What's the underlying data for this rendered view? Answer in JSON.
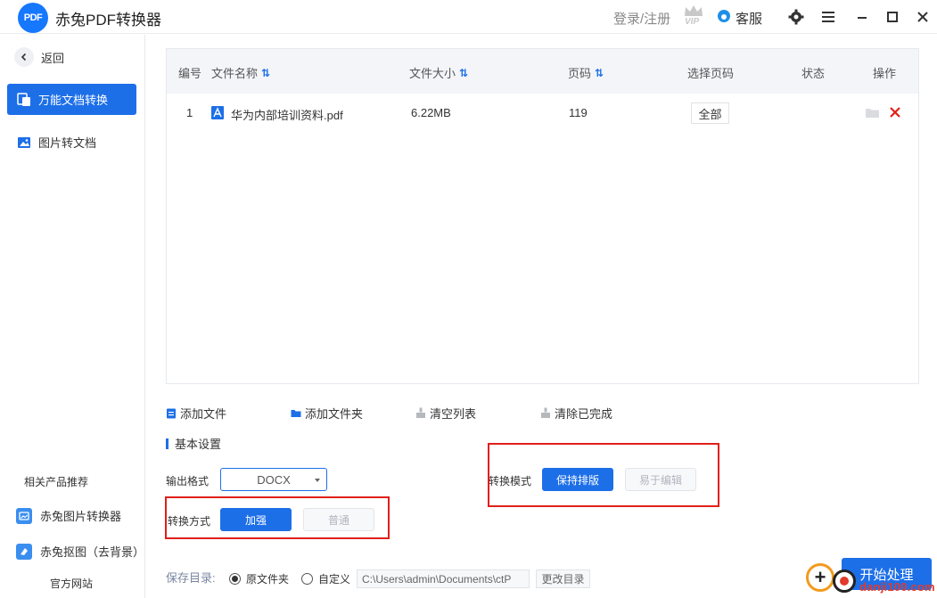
{
  "app": {
    "logo_text": "PDF",
    "title": "赤兔PDF转换器",
    "login_label": "登录/注册",
    "vip_label": "VIP",
    "service_label": "客服"
  },
  "sidebar": {
    "back_label": "返回",
    "items": [
      {
        "label": "万能文档转换",
        "active": true
      },
      {
        "label": "图片转文档",
        "active": false
      }
    ],
    "related_title": "相关产品推荐",
    "products": [
      {
        "label": "赤兔图片转换器"
      },
      {
        "label": "赤兔抠图（去背景）"
      }
    ],
    "official_label": "官方网站"
  },
  "table": {
    "headers": {
      "index": "编号",
      "name": "文件名称",
      "size": "文件大小",
      "pages": "页码",
      "select_pages": "选择页码",
      "status": "状态",
      "actions": "操作"
    },
    "rows": [
      {
        "index": "1",
        "name": "华为内部培训资料.pdf",
        "size": "6.22MB",
        "pages": "119",
        "select_pages": "全部",
        "status": ""
      }
    ]
  },
  "toolbar": {
    "add_file": "添加文件",
    "add_folder": "添加文件夹",
    "clear_list": "清空列表",
    "clear_done": "清除已完成"
  },
  "settings": {
    "title": "基本设置",
    "output_format_label": "输出格式",
    "output_format_value": "DOCX",
    "convert_method_label": "转换方式",
    "convert_method_options": [
      "加强",
      "普通"
    ],
    "convert_method_selected": "加强",
    "convert_mode_label": "转换模式",
    "convert_mode_options": [
      "保持排版",
      "易于编辑"
    ],
    "convert_mode_selected": "保持排版"
  },
  "save": {
    "label": "保存目录:",
    "option_original": "原文件夹",
    "option_custom": "自定义",
    "selected": "原文件夹",
    "path": "C:\\Users\\admin\\Documents\\ctP",
    "change_label": "更改目录"
  },
  "start_label": "开始处理",
  "watermark": {
    "text": "danji100.com"
  },
  "colors": {
    "accent": "#1d6fe8",
    "highlight_box": "#e0201a",
    "delete": "#e0201a"
  }
}
